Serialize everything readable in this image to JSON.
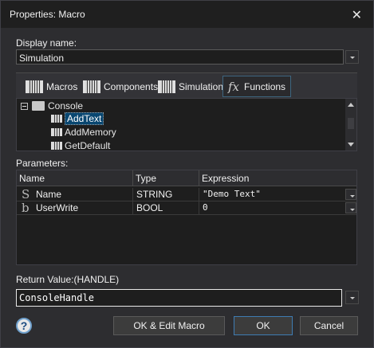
{
  "window": {
    "title": "Properties: Macro",
    "close_glyph": "✕"
  },
  "display_name": {
    "label": "Display name:",
    "value": "Simulation"
  },
  "tabs": [
    {
      "label": "Macros",
      "icon": "bars-icon"
    },
    {
      "label": "Components",
      "icon": "bars-icon"
    },
    {
      "label": "Simulation",
      "icon": "bars-icon"
    },
    {
      "label": "Functions",
      "icon": "fx-icon",
      "icon_glyph": "fx",
      "active": true
    }
  ],
  "tree": {
    "root": "Console",
    "items": [
      "AddText",
      "AddMemory",
      "GetDefault"
    ],
    "selected": "AddText"
  },
  "parameters": {
    "label": "Parameters:",
    "columns": [
      "Name",
      "Type",
      "Expression"
    ],
    "rows": [
      {
        "icon": "S",
        "name": "Name",
        "type": "STRING",
        "expression": "\"Demo Text\""
      },
      {
        "icon": "b",
        "name": "UserWrite",
        "type": "BOOL",
        "expression": "0"
      }
    ]
  },
  "return_value": {
    "label": "Return Value:(HANDLE)",
    "value": "ConsoleHandle"
  },
  "buttons": {
    "help": "?",
    "ok_edit": "OK & Edit Macro",
    "ok": "OK",
    "cancel": "Cancel"
  },
  "colors": {
    "background": "#2d2d30",
    "titlebar": "#1f1f1f",
    "selection": "#094771",
    "accent_border": "#3e7cb3"
  }
}
